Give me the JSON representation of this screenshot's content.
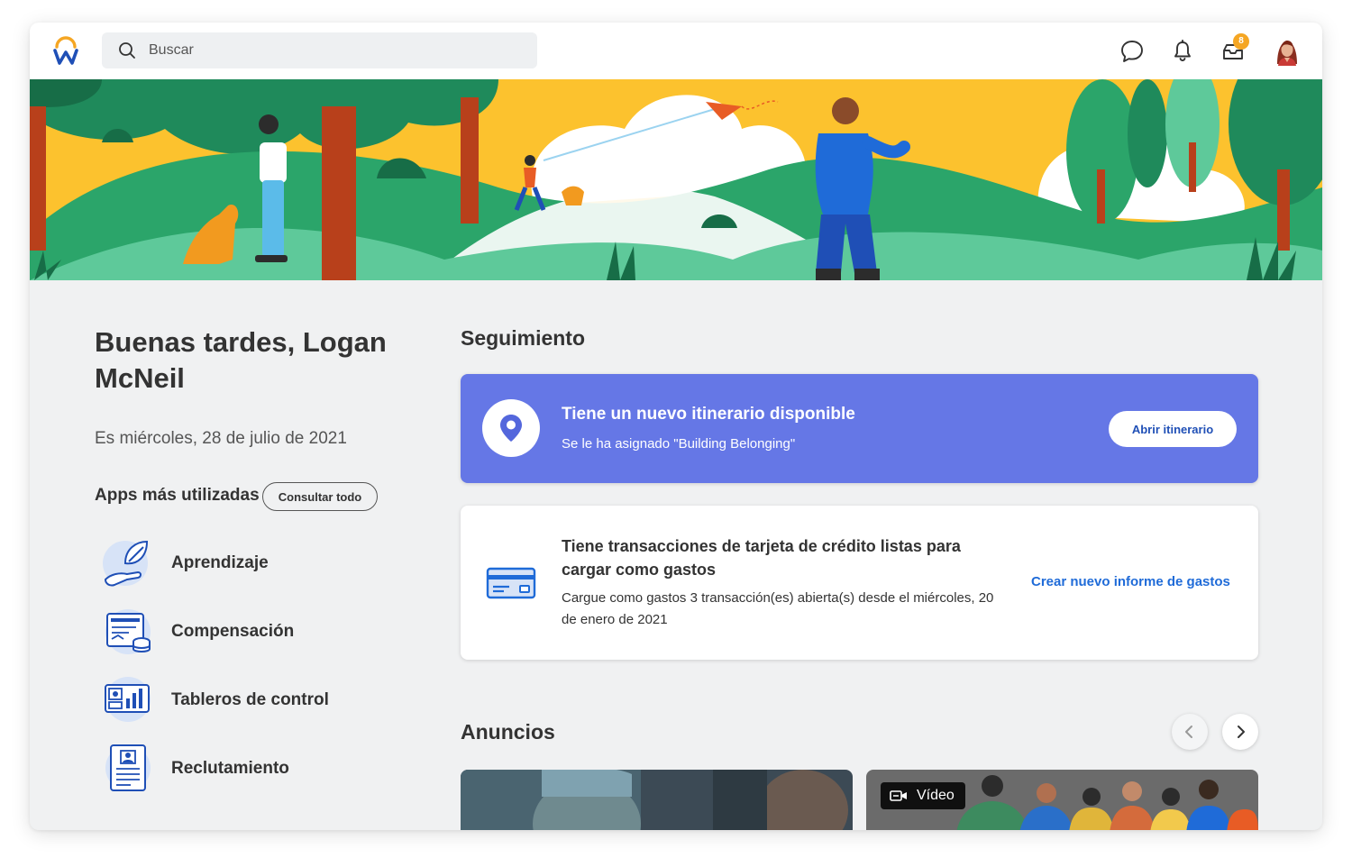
{
  "header": {
    "search_placeholder": "Buscar",
    "inbox_count": "8",
    "icons": [
      "chat-icon",
      "bell-icon",
      "inbox-icon",
      "avatar"
    ]
  },
  "greeting": {
    "title": "Buenas tardes, Logan McNeil",
    "date": "Es miércoles, 28 de julio de 2021"
  },
  "apps": {
    "title": "Apps más utilizadas",
    "see_all_label": "Consultar todo",
    "items": [
      {
        "label": "Aprendizaje",
        "icon": "learning-icon"
      },
      {
        "label": "Compensación",
        "icon": "compensation-icon"
      },
      {
        "label": "Tableros de control",
        "icon": "dashboard-icon"
      },
      {
        "label": "Reclutamiento",
        "icon": "recruiting-icon"
      }
    ]
  },
  "followup": {
    "title": "Seguimiento",
    "itinerary": {
      "title": "Tiene un nuevo itinerario disponible",
      "subtitle": "Se le ha asignado \"Building Belonging\"",
      "button_label": "Abrir itinerario"
    },
    "expenses": {
      "title": "Tiene transacciones de tarjeta de crédito listas para cargar como gastos",
      "description": "Cargue como gastos 3 transacción(es) abierta(s) desde el miércoles, 20 de enero de 2021",
      "link_label": "Crear nuevo informe de gastos"
    }
  },
  "announcements": {
    "title": "Anuncios",
    "video_label": "Vídeo"
  },
  "colors": {
    "accent_blue": "#6577e6",
    "link_blue": "#1f6bd8",
    "badge_orange": "#f5a623",
    "banner_yellow": "#fcc22e",
    "banner_green": "#2ba56a"
  }
}
